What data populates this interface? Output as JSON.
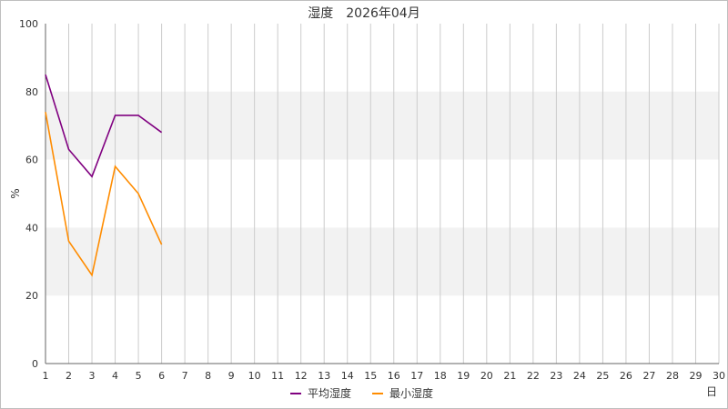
{
  "chart_data": {
    "type": "line",
    "title": "湿度　2026年04月",
    "xlabel": "日",
    "ylabel": "%",
    "xlim": [
      1,
      30
    ],
    "ylim": [
      0,
      100
    ],
    "x_ticks": [
      1,
      2,
      3,
      4,
      5,
      6,
      7,
      8,
      9,
      10,
      11,
      12,
      13,
      14,
      15,
      16,
      17,
      18,
      19,
      20,
      21,
      22,
      23,
      24,
      25,
      26,
      27,
      28,
      29,
      30
    ],
    "y_ticks": [
      0,
      20,
      40,
      60,
      80,
      100
    ],
    "grid": true,
    "legend_position": "bottom",
    "series": [
      {
        "name": "平均湿度",
        "color": "#800080",
        "x": [
          1,
          2,
          3,
          4,
          5,
          6
        ],
        "values": [
          85,
          63,
          55,
          73,
          73,
          68
        ]
      },
      {
        "name": "最小湿度",
        "color": "#ff8c00",
        "x": [
          1,
          2,
          3,
          4,
          5,
          6
        ],
        "values": [
          74,
          36,
          26,
          58,
          50,
          35
        ]
      }
    ]
  }
}
